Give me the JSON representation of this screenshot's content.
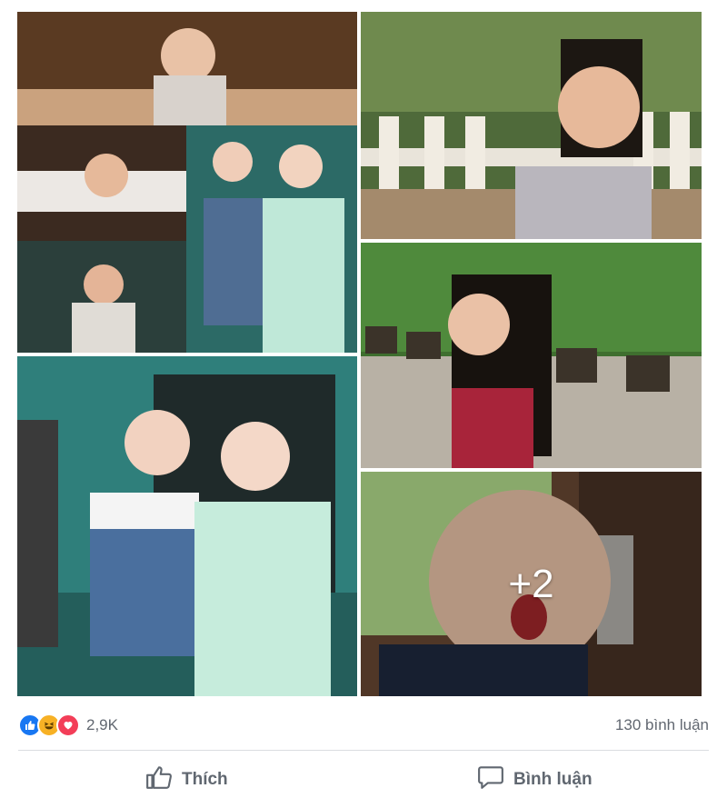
{
  "photos": {
    "more_overlay": "+2"
  },
  "reactions": {
    "icons": [
      "like-icon",
      "haha-icon",
      "love-icon"
    ],
    "colors": {
      "like": "#1877f2",
      "haha": "#f7b125",
      "love": "#f33e58"
    },
    "count": "2,9K"
  },
  "comments": {
    "count_label": "130 bình luận"
  },
  "actions": {
    "like_label": "Thích",
    "comment_label": "Bình luận"
  }
}
